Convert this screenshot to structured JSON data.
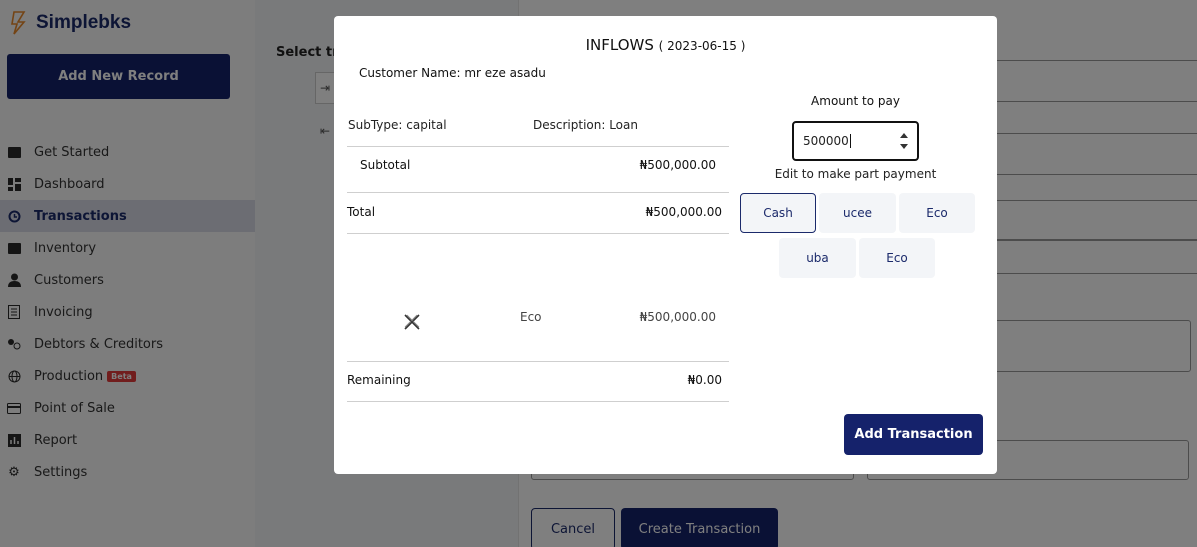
{
  "app": {
    "name": "Simplebks"
  },
  "sidebar": {
    "add_record_label": "Add New Record",
    "items": [
      {
        "label": "Get Started"
      },
      {
        "label": "Dashboard"
      },
      {
        "label": "Transactions"
      },
      {
        "label": "Inventory"
      },
      {
        "label": "Customers"
      },
      {
        "label": "Invoicing"
      },
      {
        "label": "Debtors & Creditors"
      },
      {
        "label": "Production",
        "badge": "Beta"
      },
      {
        "label": "Point of Sale"
      },
      {
        "label": "Report"
      },
      {
        "label": "Settings"
      }
    ],
    "active_item": "Transactions"
  },
  "background": {
    "select_label": "Select tra",
    "cancel_label": "Cancel",
    "create_label": "Create Transaction"
  },
  "modal": {
    "title": "INFLOWS",
    "date": "( 2023-06-15 )",
    "customer": "Customer Name: mr eze asadu",
    "subtype": "SubType: capital",
    "description": "Description: Loan",
    "subtotal_label": "Subtotal",
    "subtotal_value": "₦500,000.00",
    "total_label": "Total",
    "total_value": "₦500,000.00",
    "payment_row": {
      "method": "Eco",
      "amount": "₦500,000.00"
    },
    "remaining_label": "Remaining",
    "remaining_value": "₦0.00",
    "amount_label": "Amount to pay",
    "amount_value": "500000",
    "amount_hint": "Edit to make part payment",
    "payment_methods": [
      "Cash",
      "ucee",
      "Eco",
      "uba",
      "Eco"
    ],
    "selected_method": "Cash",
    "add_button_label": "Add Transaction"
  },
  "colors": {
    "brand": "#15226b",
    "accent_text": "#1b2a6b",
    "beta": "#e23b3b"
  }
}
